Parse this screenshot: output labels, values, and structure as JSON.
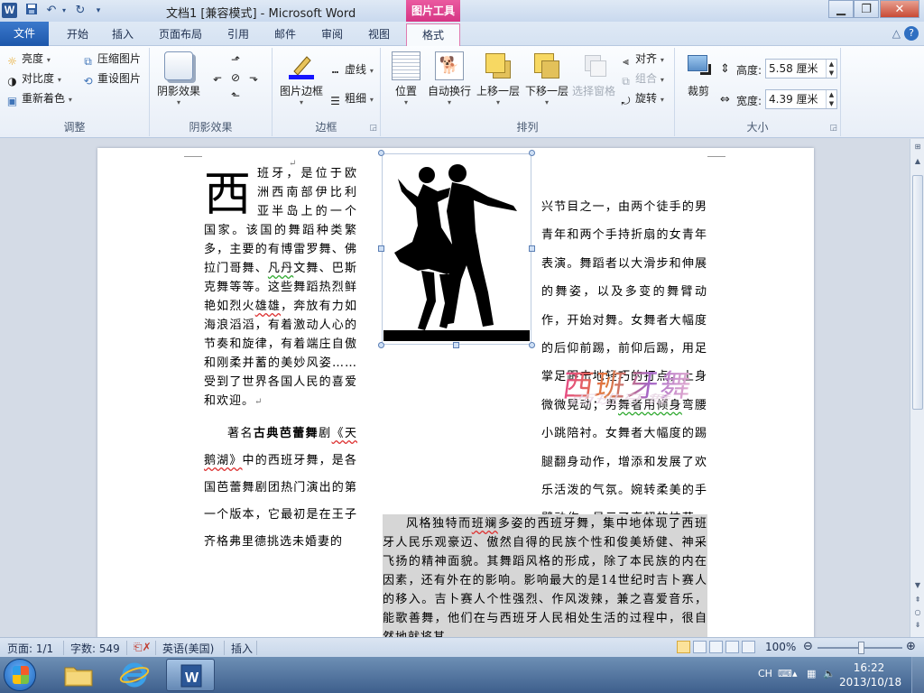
{
  "titlebar": {
    "title": "文档1 [兼容模式] - Microsoft Word",
    "context_title": "图片工具",
    "app_logo": "W"
  },
  "tabs": {
    "file": "文件",
    "home": "开始",
    "insert": "插入",
    "layout": "页面布局",
    "references": "引用",
    "mailings": "邮件",
    "review": "审阅",
    "view": "视图",
    "format": "格式"
  },
  "ribbon": {
    "adjust": {
      "label": "调整",
      "brightness": "亮度",
      "contrast": "对比度",
      "recolor": "重新着色",
      "compress": "压缩图片",
      "reset": "重设图片"
    },
    "shadow": {
      "label": "阴影效果",
      "shadow_effects": "阴影效果"
    },
    "border": {
      "label": "边框",
      "picture_border": "图片边框",
      "dashes": "虚线",
      "weight": "粗细"
    },
    "arrange": {
      "label": "排列",
      "position": "位置",
      "wrap_text": "自动换行",
      "bring_forward": "上移一层",
      "send_backward": "下移一层",
      "selection_pane": "选择窗格",
      "align": "对齐",
      "group": "组合",
      "rotate": "旋转"
    },
    "size": {
      "label": "大小",
      "crop": "裁剪",
      "height_label": "高度:",
      "height_value": "5.58 厘米",
      "width_label": "宽度:",
      "width_value": "4.39 厘米"
    }
  },
  "document": {
    "left_col": {
      "dropcap": "西",
      "p1": "班牙，是位于欧洲西南部伊比利亚半岛上的一个国家。该国的舞蹈种类繁多，主要的有博雷罗舞、佛拉门哥舞、",
      "p1_wavy": "凡丹",
      "p1b": "文舞、巴斯克舞等等。这些舞蹈热烈鲜艳如烈火",
      "p1_wavy2": "雄雄",
      "p1c": "，奔放有力如海浪滔滔，有着激动人心的节奏和旋律，有着端庄自傲和刚柔并蓄的美妙风姿……受到了世界各国人民的喜爱和欢迎。",
      "p2_pre": "著名",
      "p2_bold": "古典芭蕾舞",
      "p2a": "剧",
      "p2_title": "《天鹅湖》",
      "p2b": "中的西班牙舞，是各国芭蕾舞剧团热门演出的第一个版本，它最初是在王子齐格弗里德挑选未婚妻的"
    },
    "right_col": {
      "r1": "兴节目之一，由两个徒手的男青年和两个手持折扇的女青年表演。舞蹈者以大滑步和伸展的舞姿，以及多变的舞臂动作，开始对舞。女舞者大幅度的后仰前踢，前仰后踢，用足掌足跟击地轻巧的打点，上身微微晃动；男",
      "r1_wavy": "舞者用倾身",
      "r1b": "弯腰小跳陪衬。女舞者大幅度的踢腿翻身动作，增添和发展了欢乐活泼的气氛。婉转柔美的手臂动作，显示了高超的技艺。",
      "r2a": "风格独特而",
      "r2_wavy": "班斓",
      "r2b": "多姿的西班牙舞，集中地体现了西班牙人民乐观豪迈、傲然自得的民族个性和俊美矫健、神采飞扬的精神面貌。其舞蹈风格的形成，除了本民族的内在因素，还有外在的影响。影响最大的是14世纪时吉卜赛人的移入。吉卜赛人个性强烈、作风泼辣，兼之喜爱音乐，能歌善舞，他们在与西班牙人民相处生活的过程中，很自然地就将其"
    },
    "wordart": "西班牙舞",
    "para_mark": "↵"
  },
  "statusbar": {
    "page": "页面: 1/1",
    "words": "字数: 549",
    "language": "英语(美国)",
    "mode": "插入",
    "zoom": "100%"
  },
  "taskbar": {
    "time": "16:22",
    "date": "2013/10/18",
    "ime": "CH"
  },
  "colors": {
    "file_tab": "#1d57ab",
    "context_tab": "#d63584"
  }
}
